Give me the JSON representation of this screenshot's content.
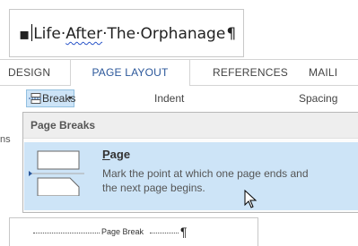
{
  "document_top": {
    "text_part1": "Life·",
    "text_misspelled": "After",
    "text_part2": "·The·Orphanage",
    "pilcrow": "¶"
  },
  "ribbon": {
    "tabs": [
      {
        "label": "DESIGN"
      },
      {
        "label": "PAGE LAYOUT"
      },
      {
        "label": "REFERENCES"
      },
      {
        "label": "MAILI"
      }
    ],
    "breaks_label": "Breaks",
    "breaks_caret": "▾",
    "indent_label": "Indent",
    "spacing_label": "Spacing",
    "left_cut_label": "ns"
  },
  "dropdown": {
    "header": "Page Breaks",
    "items": [
      {
        "title_underlined": "P",
        "title_rest": "age",
        "description": "Mark the point at which one page ends and the next page begins."
      }
    ]
  },
  "document_bottom": {
    "page_break_label": "Page Break",
    "pilcrow": "¶"
  },
  "colors": {
    "accent": "#2b579a",
    "hover_blue": "#cde4f7",
    "menu_header_bg": "#eeeeee"
  }
}
